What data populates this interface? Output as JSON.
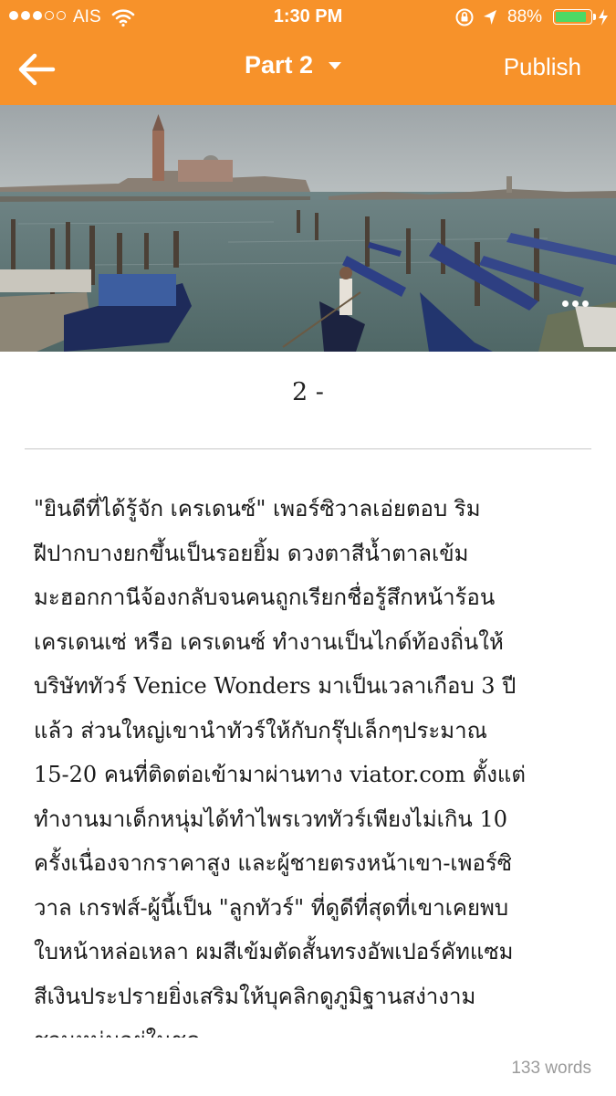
{
  "status_bar": {
    "carrier": "AIS",
    "time": "1:30 PM",
    "battery": "88%",
    "battery_level": 0.88,
    "signal_bars_filled": 3,
    "signal_bars_total": 5
  },
  "nav_bar": {
    "title": "Part 2",
    "publish_label": "Publish",
    "background_color": "#f7922a"
  },
  "chapter": {
    "title": "2 -"
  },
  "body": {
    "lines": [
      "\"ยินดีที่ได้รู้จัก เครเดนซ์\" เพอร์ซิวาลเอ่ยตอบ ริม",
      "ฝีปากบางยกขึ้นเป็นรอยยิ้ม ดวงตาสีน้ำตาลเข้ม",
      "มะฮอกกานีจ้องกลับจนคนถูกเรียกชื่อรู้สึกหน้าร้อน",
      "เครเดนเซ่ หรือ เครเดนซ์ ทำงานเป็นไกด์ท้องถิ่นให้",
      "บริษัททัวร์ Venice Wonders มาเป็นเวลาเกือบ 3 ปี",
      "แล้ว ส่วนใหญ่เขานำทัวร์ให้กับกรุ๊ปเล็กๆประมาณ",
      "15-20 คนที่ติดต่อเข้ามาผ่านทาง viator.com ตั้งแต่",
      "ทำงานมาเด็กหนุ่มได้ทำไพรเวททัวร์เพียงไม่เกิน 10",
      "ครั้งเนื่องจากราคาสูง และผู้ชายตรงหน้าเขา-เพอร์ซิ",
      "วาล เกรฟส์-ผู้นี้เป็น \"ลูกทัวร์\" ที่ดูดีที่สุดที่เขาเคยพบ",
      "ใบหน้าหล่อเหลา ผมสีเข้มตัดสั้นทรงอัพเปอร์คัทแซม",
      "สีเงินประปรายยิ่งเสริมให้บุคลิกดูภูมิฐานสง่างาม",
      "ชวนหน่มอยู่ในชุด"
    ]
  },
  "footer": {
    "word_count": "133 words"
  },
  "icons": {
    "back": "arrow-left-icon",
    "dropdown": "caret-down-icon",
    "more": "more-horizontal-icon",
    "wifi": "wifi-icon",
    "lock": "rotation-lock-icon",
    "location": "location-arrow-icon",
    "battery": "battery-icon",
    "charging": "charging-bolt-icon"
  }
}
